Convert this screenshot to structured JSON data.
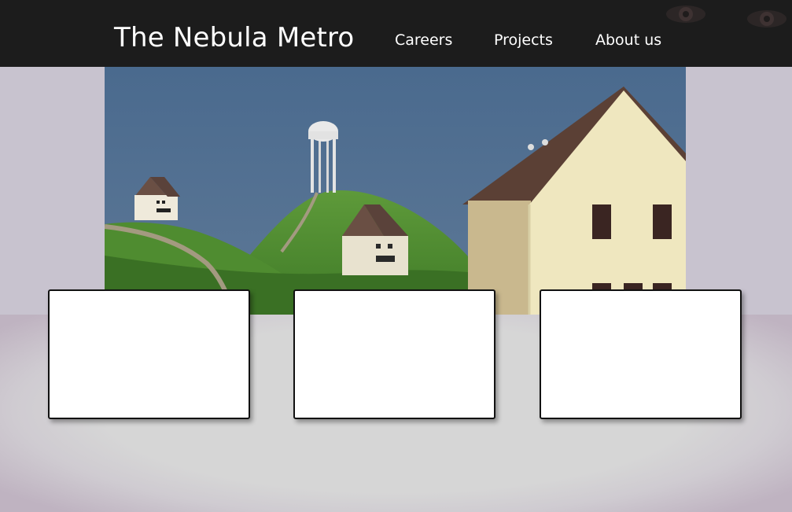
{
  "header": {
    "site_title": "The Nebula Metro",
    "nav": [
      {
        "label": "Careers"
      },
      {
        "label": "Projects"
      },
      {
        "label": "About us"
      }
    ]
  },
  "hero": {
    "image": "hillside-houses-illustration"
  },
  "cards": [
    {
      "content": ""
    },
    {
      "content": ""
    },
    {
      "content": ""
    }
  ],
  "colors": {
    "header_bg": "#1c1c1c",
    "header_text": "#ffffff",
    "page_bg": "#c9c4ce",
    "card_bg": "#ffffff",
    "card_border": "#111111"
  }
}
